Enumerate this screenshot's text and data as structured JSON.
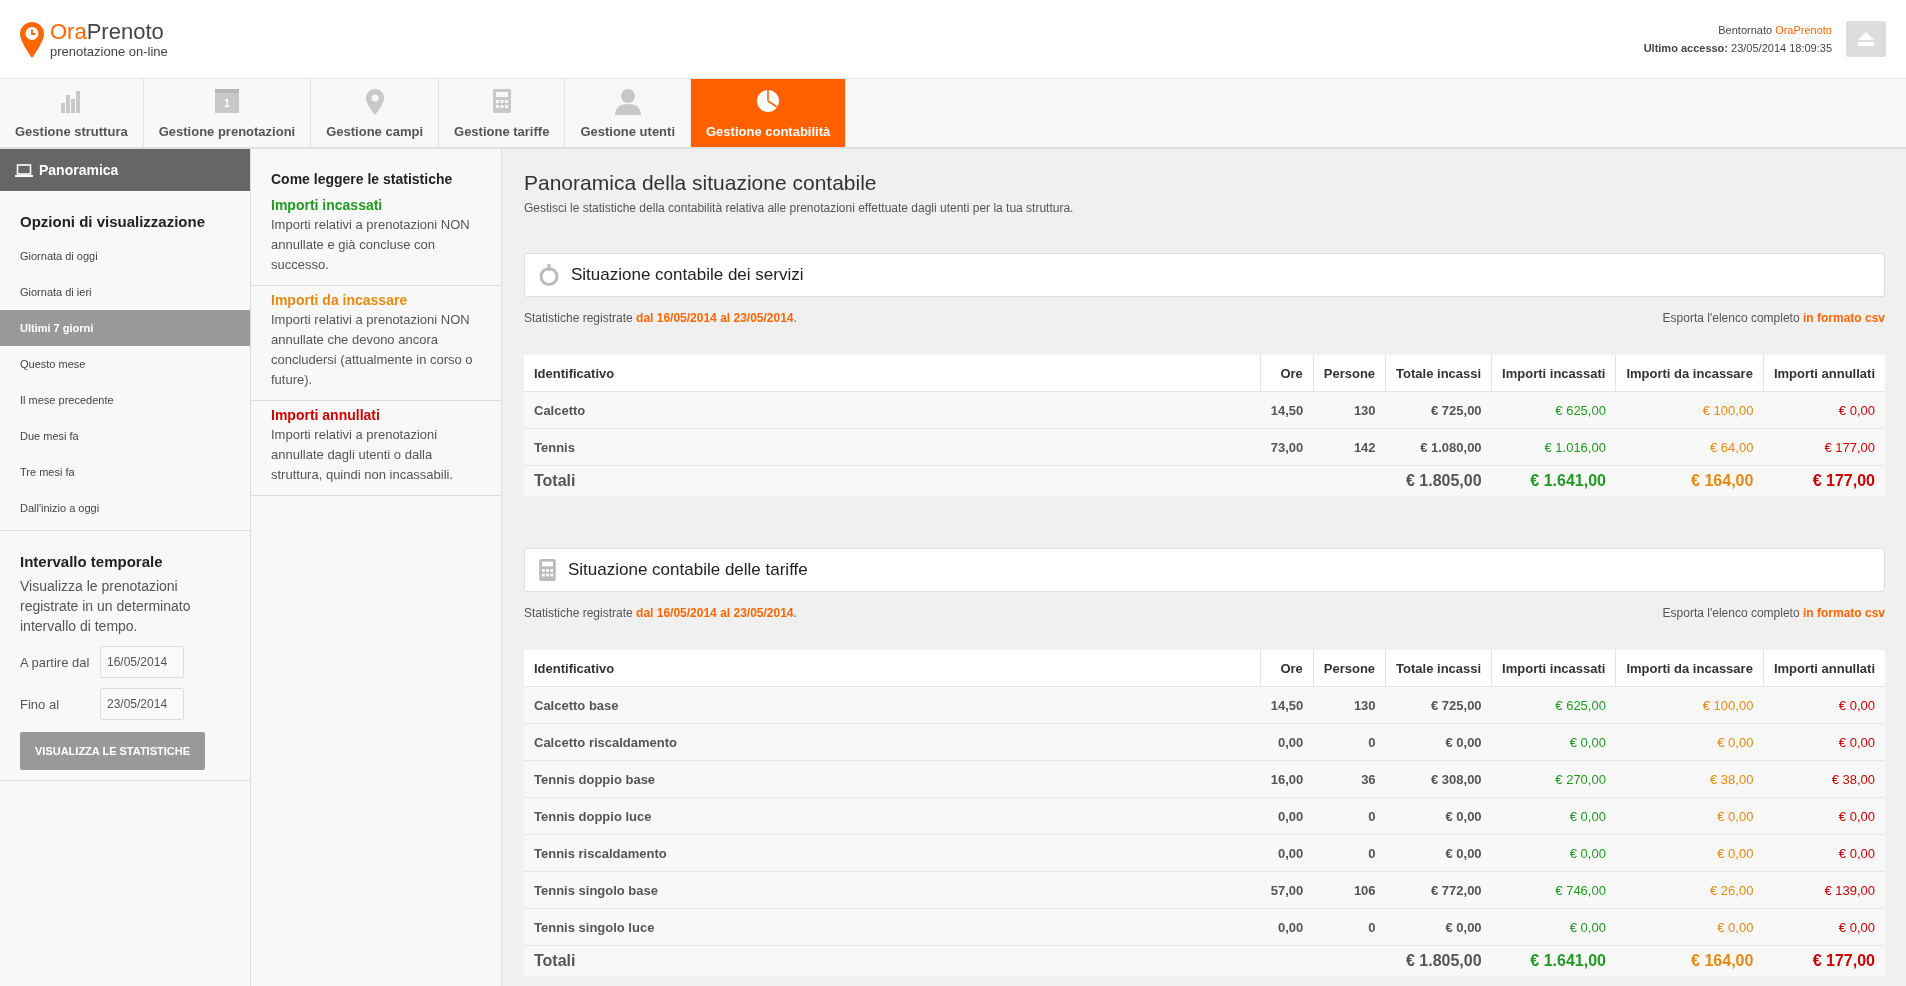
{
  "header": {
    "brand_first": "Ora",
    "brand_second": "Prenoto",
    "tagline": "prenotazione on-line",
    "greeting": "Bentornato",
    "user": "OraPrenoto",
    "last_access_label": "Ultimo accesso:",
    "last_access": "23/05/2014 18:09:35"
  },
  "nav_tabs": [
    {
      "label": "Gestione struttura",
      "kind": "bars",
      "selected": false
    },
    {
      "label": "Gestione prenotazioni",
      "kind": "calendar",
      "icon_text": "1",
      "selected": false
    },
    {
      "label": "Gestione campi",
      "kind": "pin",
      "selected": false
    },
    {
      "label": "Gestione tariffe",
      "kind": "calculator",
      "selected": false
    },
    {
      "label": "Gestione utenti",
      "kind": "person",
      "selected": false
    },
    {
      "label": "Gestione contabilità",
      "kind": "pie",
      "selected": true
    }
  ],
  "sidebar": {
    "header": "Panoramica",
    "options_title": "Opzioni di visualizzazione",
    "items": [
      {
        "label": "Giornata di oggi",
        "selected": false
      },
      {
        "label": "Giornata di ieri",
        "selected": false
      },
      {
        "label": "Ultimi 7 giorni",
        "selected": true
      },
      {
        "label": "Questo mese",
        "selected": false
      },
      {
        "label": "Il mese precedente",
        "selected": false
      },
      {
        "label": "Due mesi fa",
        "selected": false
      },
      {
        "label": "Tre mesi fa",
        "selected": false
      },
      {
        "label": "Dall'inizio a oggi",
        "selected": false
      }
    ],
    "interval_title": "Intervallo temporale",
    "interval_text": "Visualizza le prenotazioni registrate in un determinato intervallo di tempo.",
    "fields": [
      {
        "label": "A partire dal",
        "value": "16/05/2014"
      },
      {
        "label": "Fino al",
        "value": "23/05/2014"
      }
    ],
    "button": "VISUALIZZA LE STATISTICHE"
  },
  "legend": {
    "title": "Come leggere le statistiche",
    "entries": [
      {
        "kind": "collected",
        "title": "Importi incassati",
        "text": "Importi relativi a prenotazioni NON annullate e già concluse con successo."
      },
      {
        "kind": "pending",
        "title": "Importi da incassare",
        "text": "Importi relativi a prenotazioni NON annullate che devono ancora concludersi (attualmente in corso o future)."
      },
      {
        "kind": "cancelled",
        "title": "Importi annullati",
        "text": "Importi relativi a prenotazioni annullate dagli utenti o dalla struttura, quindi non incassabili."
      }
    ]
  },
  "main": {
    "title": "Panoramica della situazione contabile",
    "subtitle": "Gestisci le statistiche della contabilità relativa alle prenotazioni effettuate dagli utenti per la tua struttura.",
    "sections": [
      {
        "title": "Situazione contabile dei servizi",
        "kind": "services",
        "period": "Statistiche registrate **dal 16/05/2014 al 23/05/2014**.",
        "export_text": "Esporta l'elenco completo",
        "export_link": "in formato csv",
        "columns": [
          {
            "label": "Identificativo",
            "kind": "name"
          },
          {
            "label": "Ore",
            "kind": "num"
          },
          {
            "label": "Persone",
            "kind": "num"
          },
          {
            "label": "Totale incassi",
            "kind": "num"
          },
          {
            "label": "Importi incassati",
            "kind": "collected"
          },
          {
            "label": "Importi da incassare",
            "kind": "pending"
          },
          {
            "label": "Importi annullati",
            "kind": "cancelled"
          }
        ],
        "rows": [
          [
            "Calcetto",
            "14,50",
            "130",
            "€ 725,00",
            "€ 625,00",
            "€ 100,00",
            "€ 0,00"
          ],
          [
            "Tennis",
            "73,00",
            "142",
            "€ 1.080,00",
            "€ 1.016,00",
            "€ 64,00",
            "€ 177,00"
          ]
        ],
        "totals": {
          "label": "Totali",
          "amounts": [
            "€ 1.805,00",
            "€ 1.641,00",
            "€ 164,00",
            "€ 177,00"
          ]
        }
      },
      {
        "title": "Situazione contabile delle tariffe",
        "kind": "rates",
        "period": "Statistiche registrate **dal 16/05/2014 al 23/05/2014**.",
        "export_text": "Esporta l'elenco completo",
        "export_link": "in formato csv",
        "columns": [
          {
            "label": "Identificativo",
            "kind": "name"
          },
          {
            "label": "Ore",
            "kind": "num"
          },
          {
            "label": "Persone",
            "kind": "num"
          },
          {
            "label": "Totale incassi",
            "kind": "num"
          },
          {
            "label": "Importi incassati",
            "kind": "collected"
          },
          {
            "label": "Importi da incassare",
            "kind": "pending"
          },
          {
            "label": "Importi annullati",
            "kind": "cancelled"
          }
        ],
        "rows": [
          [
            "Calcetto base",
            "14,50",
            "130",
            "€ 725,00",
            "€ 625,00",
            "€ 100,00",
            "€ 0,00"
          ],
          [
            "Calcetto riscaldamento",
            "0,00",
            "0",
            "€ 0,00",
            "€ 0,00",
            "€ 0,00",
            "€ 0,00"
          ],
          [
            "Tennis doppio base",
            "16,00",
            "36",
            "€ 308,00",
            "€ 270,00",
            "€ 38,00",
            "€ 38,00"
          ],
          [
            "Tennis doppio luce",
            "0,00",
            "0",
            "€ 0,00",
            "€ 0,00",
            "€ 0,00",
            "€ 0,00"
          ],
          [
            "Tennis riscaldamento",
            "0,00",
            "0",
            "€ 0,00",
            "€ 0,00",
            "€ 0,00",
            "€ 0,00"
          ],
          [
            "Tennis singolo base",
            "57,00",
            "106",
            "€ 772,00",
            "€ 746,00",
            "€ 26,00",
            "€ 139,00"
          ],
          [
            "Tennis singolo luce",
            "0,00",
            "0",
            "€ 0,00",
            "€ 0,00",
            "€ 0,00",
            "€ 0,00"
          ]
        ],
        "totals": {
          "label": "Totali",
          "amounts": [
            "€ 1.805,00",
            "€ 1.641,00",
            "€ 164,00",
            "€ 177,00"
          ]
        }
      }
    ]
  }
}
